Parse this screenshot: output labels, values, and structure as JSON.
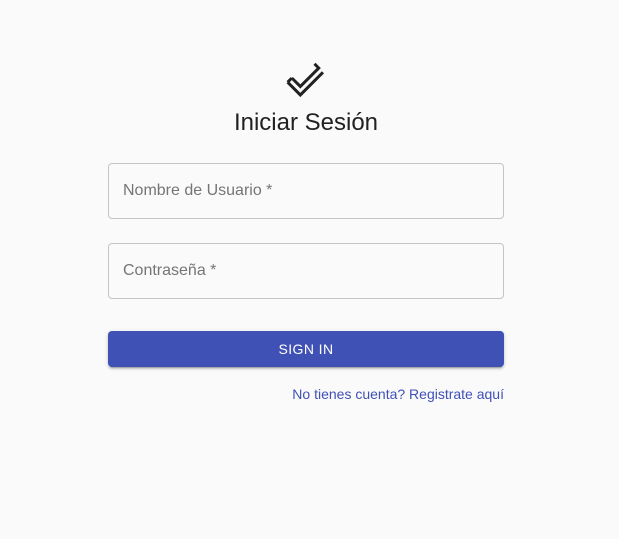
{
  "logo": {
    "icon": "check-box-outline-icon"
  },
  "title": "Iniciar Sesión",
  "username": {
    "label": "Nombre de Usuario *",
    "value": ""
  },
  "password": {
    "label": "Contraseña *",
    "value": ""
  },
  "signin_button": "SIGN IN",
  "register_link": "No tienes cuenta? Registrate aquí",
  "colors": {
    "primary": "#3f51b5",
    "background": "#fafafa",
    "border": "#c4c4c4",
    "label": "#757575"
  }
}
